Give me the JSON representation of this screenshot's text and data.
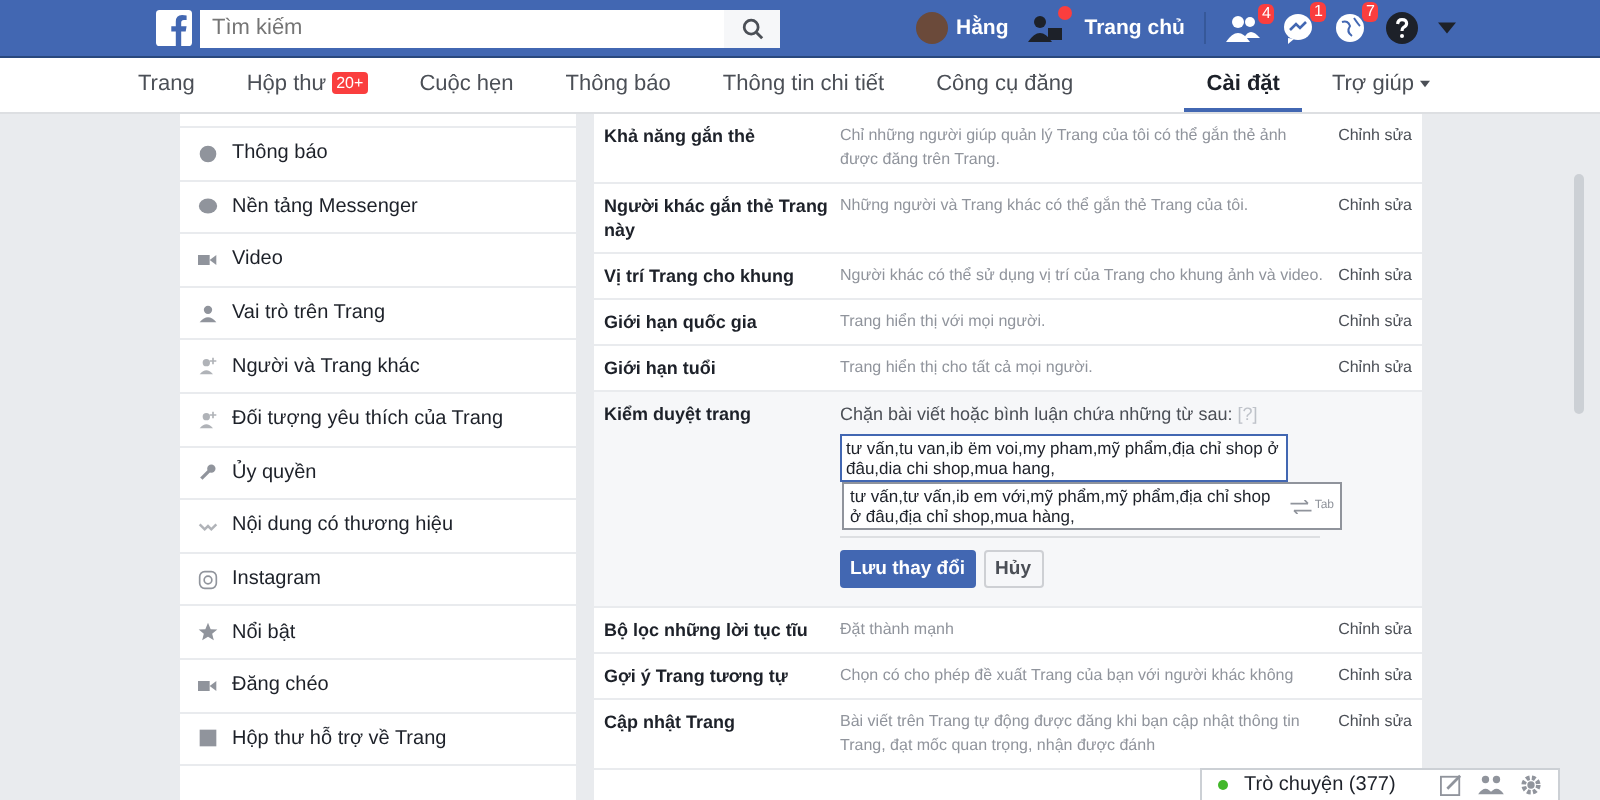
{
  "topbar": {
    "search": {
      "placeholder": "Tìm kiếm"
    },
    "user": "Hằng",
    "home": "Trang chủ",
    "friend_requests_badge": true,
    "badges": [
      {
        "kind": "friends",
        "count": "4"
      },
      {
        "kind": "messages",
        "count": "1"
      },
      {
        "kind": "notifications",
        "count": "7"
      }
    ]
  },
  "tabs": [
    {
      "label": "Trang",
      "selected": false
    },
    {
      "label": "Hộp thư",
      "badge": "20+",
      "selected": false
    },
    {
      "label": "Cuộc hẹn",
      "selected": false
    },
    {
      "label": "Thông báo",
      "selected": false
    },
    {
      "label": "Thông tin chi tiết",
      "selected": false
    },
    {
      "label": "Công cụ đăng",
      "selected": false
    },
    {
      "label": "Cài đặt",
      "selected": true
    },
    {
      "label": "Trợ giúp",
      "dropdown": true,
      "selected": false
    }
  ],
  "sidebar": {
    "items": [
      {
        "label": "Thông báo"
      },
      {
        "label": "Nền tảng Messenger"
      },
      {
        "label": "Video"
      },
      {
        "label": "Vai trò trên Trang"
      },
      {
        "label": "Người và Trang khác"
      },
      {
        "label": "Đối tượng yêu thích của Trang"
      },
      {
        "label": "Ủy quyền"
      },
      {
        "label": "Nội dung có thương hiệu"
      },
      {
        "label": "Instagram"
      },
      {
        "label": "Nổi bật"
      },
      {
        "label": "Đăng chéo"
      },
      {
        "label": "Hộp thư hỗ trợ về Trang"
      }
    ]
  },
  "settings": [
    {
      "kind": "row",
      "name": "Khả năng gắn thẻ",
      "description": "Chỉ những người giúp quản lý Trang của tôi có thể gắn thẻ ảnh được đăng trên Trang.",
      "action": "Chỉnh sửa"
    },
    {
      "kind": "row",
      "name": "Người khác gắn thẻ Trang này",
      "description": "Những người và Trang khác có thể gắn thẻ Trang của tôi.",
      "action": "Chỉnh sửa"
    },
    {
      "kind": "row",
      "name": "Vị trí Trang cho khung",
      "description": "Người khác có thể sử dụng vị trí của Trang cho khung ảnh và video.",
      "action": "Chỉnh sửa"
    },
    {
      "kind": "row",
      "name": "Giới hạn quốc gia",
      "description": "Trang hiển thị với mọi người.",
      "action": "Chỉnh sửa"
    },
    {
      "kind": "row",
      "name": "Giới hạn tuổi",
      "description": "Trang hiển thị cho tất cả mọi người.",
      "action": "Chỉnh sửa"
    },
    {
      "kind": "editor",
      "name": "Kiểm duyệt trang",
      "prompt": "Chặn bài viết hoặc bình luận chứa những từ sau:",
      "help": "[?]",
      "value": "tư vấn,tu van,ib ëm voi,my pham,mỹ phẩm,địa chỉ shop ở đâu,dia chi shop,mua hang,",
      "suggestion": "tư vấn,tư vấn,ib em với,mỹ phẩm,mỹ phẩm,địa chỉ shop ở đâu,địa chỉ shop,mua hàng,",
      "suggestion_key": "Tab",
      "save": "Lưu thay đổi",
      "cancel": "Hủy"
    },
    {
      "kind": "row",
      "name": "Bộ lọc những lời tục tĩu",
      "description": "Đặt thành mạnh",
      "action": "Chỉnh sửa"
    },
    {
      "kind": "row",
      "name": "Gợi ý Trang tương tự",
      "description": "Chọn có cho phép đề xuất Trang của bạn với người khác không",
      "action": "Chỉnh sửa"
    },
    {
      "kind": "row",
      "name": "Cập nhật Trang",
      "description": "Bài viết trên Trang tự động được đăng khi bạn cập nhật thông tin Trang, đạt mốc quan trọng, nhận được đánh",
      "action": "Chỉnh sửa"
    }
  ],
  "chat": {
    "label": "Trò chuyện (377)",
    "online": true
  }
}
